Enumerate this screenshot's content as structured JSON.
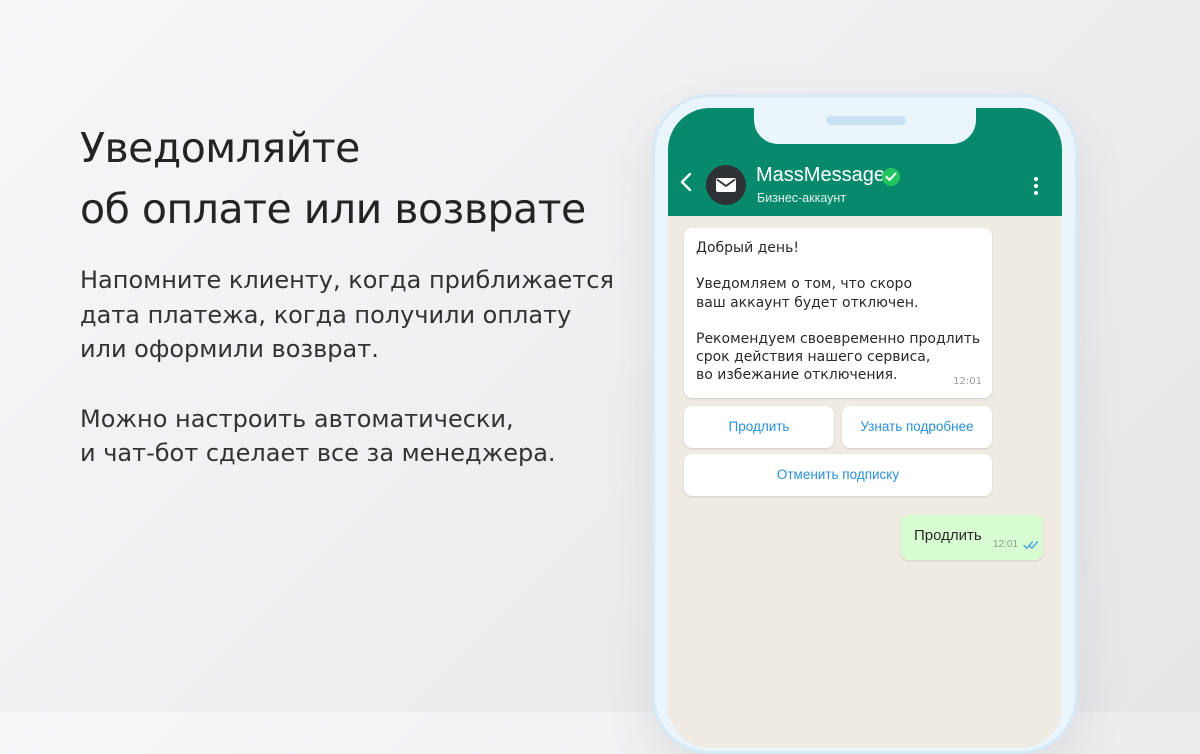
{
  "promo": {
    "headline": [
      "Уведомляйте",
      "об оплате или возврате"
    ],
    "paragraph1": [
      "Напомните клиенту, когда приближается",
      "дата платежа, когда получили оплату",
      "или оформили возврат."
    ],
    "paragraph2": [
      "Можно настроить автоматически,",
      "и чат-бот сделает все за менеджера."
    ]
  },
  "chat": {
    "header": {
      "back_icon": "chevron-left-icon",
      "avatar_icon": "envelope-icon",
      "name": "MassMessage",
      "verified_icon": "verified-check-icon",
      "subtitle": "Бизнес-аккаунт",
      "menu_icon": "more-vertical-icon",
      "color": "#078a6c"
    },
    "incoming": {
      "greeting": "Добрый день!",
      "body1": [
        "Уведомляем о том, что скоро",
        "ваш аккаунт будет отключен."
      ],
      "body2": [
        "Рекомендуем своевременно продлить",
        "срок действия нашего сервиса,",
        "во избежание отключения."
      ],
      "time": "12:01"
    },
    "buttons": {
      "renew": "Продлить",
      "details": "Узнать подробнее",
      "cancel": "Отменить подписку",
      "color": "#2b8fd6"
    },
    "outgoing": {
      "text": "Продлить",
      "time": "12:01",
      "status_icon": "double-check-icon",
      "color": "#d9fdd3"
    }
  }
}
